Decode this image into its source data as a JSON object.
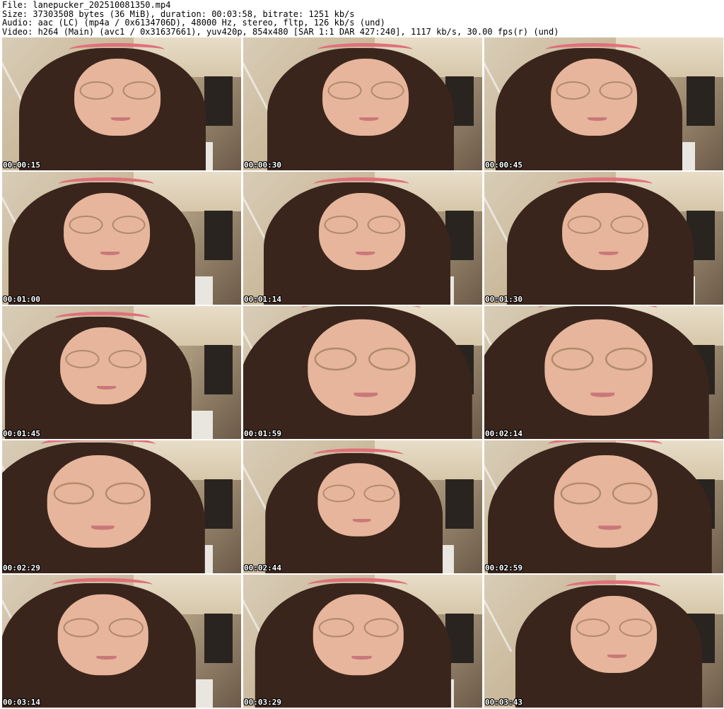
{
  "header": {
    "file": "File: lanepucker_202510081350.mp4",
    "size": "Size: 37303508 bytes (36 MiB), duration: 00:03:58, bitrate: 1251 kb/s",
    "audio": "Audio: aac (LC) (mp4a / 0x6134706D), 48000 Hz, stereo, fltp, 126 kb/s (und)",
    "video": "Video: h264 (Main) (avc1 / 0x31637661), yuv420p, 854x480 [SAR 1:1 DAR 427:240], 1117 kb/s, 30.00 fps(r) (und)"
  },
  "thumbnails": [
    {
      "timestamp": "00:00:15"
    },
    {
      "timestamp": "00:00:30"
    },
    {
      "timestamp": "00:00:45"
    },
    {
      "timestamp": "00:01:00"
    },
    {
      "timestamp": "00:01:14"
    },
    {
      "timestamp": "00:01:30"
    },
    {
      "timestamp": "00:01:45"
    },
    {
      "timestamp": "00:01:59"
    },
    {
      "timestamp": "00:02:14"
    },
    {
      "timestamp": "00:02:29"
    },
    {
      "timestamp": "00:02:44"
    },
    {
      "timestamp": "00:02:59"
    },
    {
      "timestamp": "00:03:14"
    },
    {
      "timestamp": "00:03:29"
    },
    {
      "timestamp": "00:03:43"
    }
  ]
}
